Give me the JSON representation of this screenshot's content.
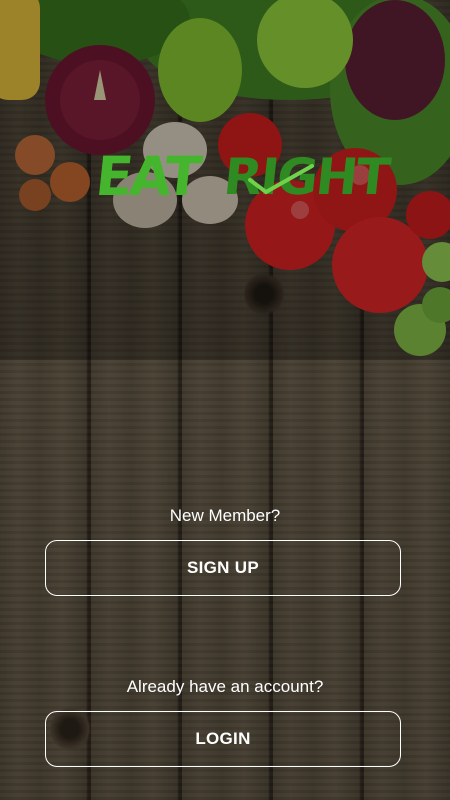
{
  "brand": {
    "logo_word_1": "EAT",
    "logo_word_2": "RIGHT",
    "colors": {
      "eat": "#46b52e",
      "right": "#2f8a22"
    }
  },
  "signup": {
    "prompt": "New Member?",
    "button_label": "SIGN UP"
  },
  "login": {
    "prompt": "Already have an account?",
    "button_label": "LOGIN"
  },
  "background": {
    "theme": "wooden-planks-with-vegetables"
  }
}
